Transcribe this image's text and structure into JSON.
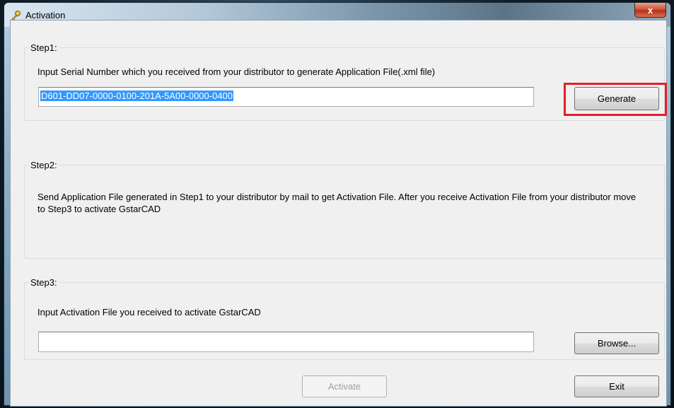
{
  "window": {
    "title": "Activation",
    "close_label": "x"
  },
  "step1": {
    "label": "Step1:",
    "description": "Input Serial Number which you received from your distributor to generate Application File(.xml file)",
    "serial_value": "D601-DD07-0000-0100-201A-5A00-0000-0400",
    "generate_label": "Generate"
  },
  "step2": {
    "label": "Step2:",
    "description": "Send Application File generated in Step1 to your distributor by mail to get Activation File. After you receive Activation File from your distributor move to Step3 to activate GstarCAD"
  },
  "step3": {
    "label": "Step3:",
    "description": "Input Activation File you received to activate GstarCAD",
    "file_value": "",
    "browse_label": "Browse..."
  },
  "footer": {
    "activate_label": "Activate",
    "exit_label": "Exit"
  },
  "colors": {
    "highlight": "#e0202a",
    "selection": "#3399ff"
  }
}
